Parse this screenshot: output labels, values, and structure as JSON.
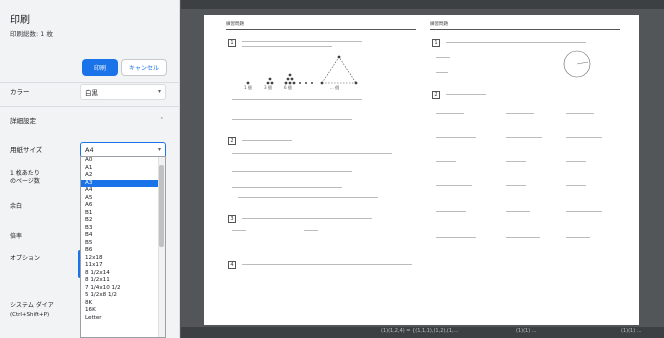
{
  "panel": {
    "title": "印刷",
    "sheet_count": "印刷総数: 1 枚",
    "print_button": "印刷",
    "cancel_button": "キャンセル",
    "color_label": "カラー",
    "color_value": "白黒",
    "details_label": "詳細設定",
    "paper_size_label": "用紙サイズ",
    "paper_size_value": "A4",
    "pages_per_sheet_label_1": "1 枚あたり",
    "pages_per_sheet_label_2": "のページ数",
    "margins_label": "余白",
    "scale_label": "倍率",
    "options_label": "オプション",
    "system_dialog_label_1": "システム ダイア",
    "system_dialog_label_2": "(Ctrl+Shift+P)"
  },
  "paper_sizes": [
    "A0",
    "A1",
    "A2",
    "A3",
    "A4",
    "A5",
    "A6",
    "B1",
    "B2",
    "B3",
    "B4",
    "B5",
    "B6",
    "12x18",
    "11x17",
    "8 1/2x14",
    "8 1/2x11",
    "7 1/4x10 1/2",
    "5 1/2x8 1/2",
    "8K",
    "16K",
    "Letter"
  ],
  "selected_paper_size": "A3",
  "preview": {
    "left_heading": "練習問題",
    "right_heading": "練習問題",
    "q1": "1",
    "q2": "2",
    "q3": "3",
    "q4": "4",
    "r1": "1",
    "r2": "2",
    "fig_labels": [
      "1 個",
      "3 個",
      "6 個",
      "... 個"
    ],
    "bottom_text_1": "(1)(1,2,4) = {(1,1,1),(1,2),(1,...",
    "bottom_text_2": "(1)(1) ...",
    "bottom_text_3": "(1)(1) ..."
  }
}
